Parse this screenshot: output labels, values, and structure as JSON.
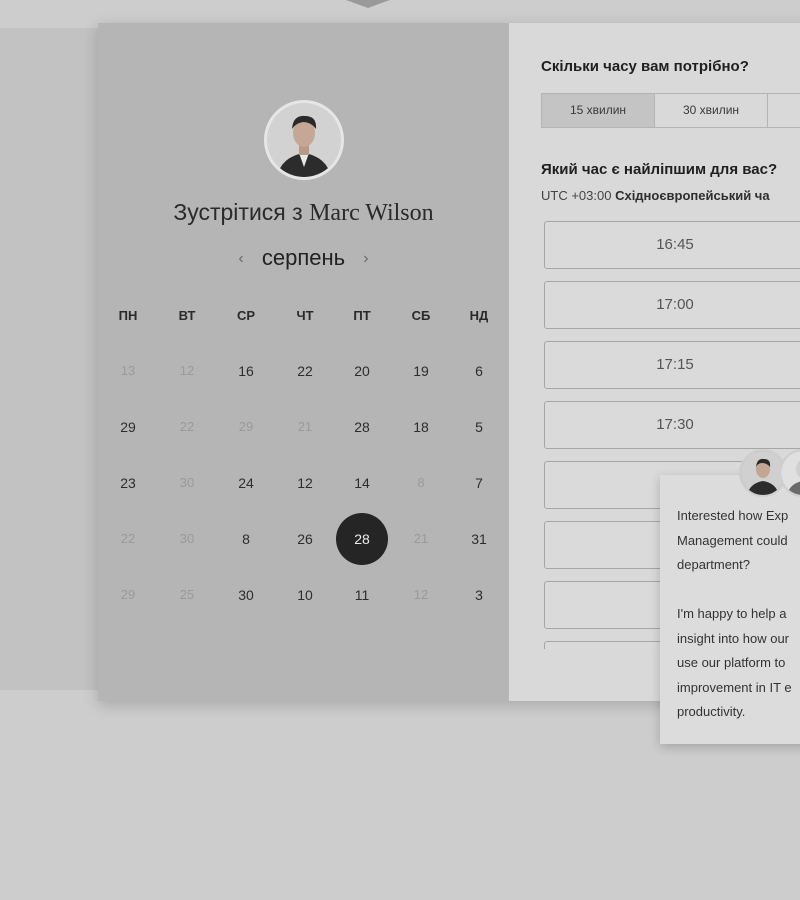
{
  "scheduler": {
    "title_prefix": "Зустрітися з",
    "host_name": "Marc Wilson",
    "month": "серпень",
    "prev_icon": "‹",
    "next_icon": "›",
    "weekdays": [
      "ПН",
      "ВТ",
      "СР",
      "ЧТ",
      "ПТ",
      "СБ",
      "НД"
    ],
    "weeks": [
      [
        {
          "d": "13",
          "muted": true
        },
        {
          "d": "12",
          "muted": true
        },
        {
          "d": "16",
          "muted": false
        },
        {
          "d": "22",
          "muted": false
        },
        {
          "d": "20",
          "muted": false
        },
        {
          "d": "19",
          "muted": false
        },
        {
          "d": "6",
          "muted": false
        }
      ],
      [
        {
          "d": "29",
          "muted": false
        },
        {
          "d": "22",
          "muted": true
        },
        {
          "d": "29",
          "muted": true
        },
        {
          "d": "21",
          "muted": true
        },
        {
          "d": "28",
          "muted": false
        },
        {
          "d": "18",
          "muted": false
        },
        {
          "d": "5",
          "muted": false
        }
      ],
      [
        {
          "d": "23",
          "muted": false
        },
        {
          "d": "30",
          "muted": true
        },
        {
          "d": "24",
          "muted": false
        },
        {
          "d": "12",
          "muted": false
        },
        {
          "d": "14",
          "muted": false
        },
        {
          "d": "8",
          "muted": true
        },
        {
          "d": "7",
          "muted": false
        }
      ],
      [
        {
          "d": "22",
          "muted": true
        },
        {
          "d": "30",
          "muted": true
        },
        {
          "d": "8",
          "muted": false
        },
        {
          "d": "26",
          "muted": false
        },
        {
          "d": "28",
          "muted": false,
          "selected": true
        },
        {
          "d": "21",
          "muted": true
        },
        {
          "d": "31",
          "muted": false
        }
      ],
      [
        {
          "d": "29",
          "muted": true
        },
        {
          "d": "25",
          "muted": true
        },
        {
          "d": "30",
          "muted": false
        },
        {
          "d": "10",
          "muted": false
        },
        {
          "d": "11",
          "muted": false
        },
        {
          "d": "12",
          "muted": true
        },
        {
          "d": "3",
          "muted": false
        }
      ]
    ]
  },
  "booking": {
    "duration_question": "Скільки часу вам потрібно?",
    "durations": [
      "15 хвилин",
      "30 хвилин",
      ""
    ],
    "time_question": "Який час є найліпшим для вас?",
    "timezone_offset": "UTC +03:00",
    "timezone_name": "Східноєвропейський ча",
    "slots": [
      "16:45",
      "17:00",
      "17:15",
      "17:30",
      "",
      "",
      "",
      ""
    ]
  },
  "chat": {
    "lines": [
      "Interested how Exp",
      "Management could",
      "department?",
      "",
      "I'm happy to help a",
      "insight into how our",
      "use our platform to",
      "improvement in IT e",
      "productivity."
    ]
  },
  "colors": {
    "selected_day": "#252525",
    "left_panel": "#b5b5b5",
    "right_panel": "#d9d9d9"
  }
}
